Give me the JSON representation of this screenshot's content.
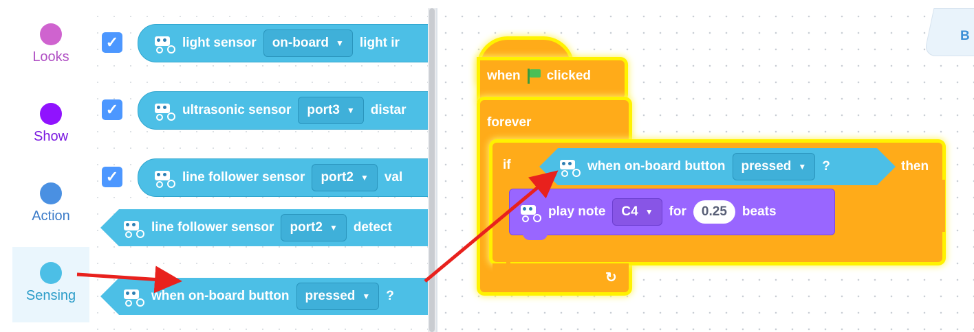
{
  "sidebar": {
    "categories": [
      {
        "label": "Looks",
        "color": "#cf63cf"
      },
      {
        "label": "Show",
        "color": "#9013fe"
      },
      {
        "label": "Action",
        "color": "#4a90e2"
      },
      {
        "label": "Sensing",
        "color": "#4cbfe6"
      }
    ]
  },
  "palette": {
    "blocks": [
      {
        "text": "light sensor",
        "dropdown": "on-board",
        "tail": "light ir",
        "checked": true
      },
      {
        "text": "ultrasonic sensor",
        "dropdown": "port3",
        "tail": "distar",
        "checked": true
      },
      {
        "text": "line follower sensor",
        "dropdown": "port2",
        "tail": "val",
        "checked": true
      },
      {
        "text": "line follower sensor",
        "dropdown": "port2",
        "tail": "detect"
      },
      {
        "text": "when on-board button",
        "dropdown": "pressed",
        "tail": "?"
      }
    ]
  },
  "workspace": {
    "tab_label": "B",
    "hat": {
      "when": "when",
      "clicked": "clicked"
    },
    "forever": "forever",
    "if": {
      "if": "if",
      "condition": "when on-board button",
      "dropdown": "pressed",
      "q": "?",
      "then": "then"
    },
    "note": {
      "play": "play note",
      "note": "C4",
      "for": "for",
      "beats_value": "0.25",
      "beats": "beats"
    },
    "loop_icon": "↻"
  },
  "colors": {
    "sensing": "#4cbfe6",
    "control": "#ffab19",
    "sound": "#9966ff",
    "glow": "#fff200",
    "arrow": "#e8211d"
  },
  "icons": [
    "check-icon",
    "dropdown-arrow-icon",
    "green-flag-icon",
    "loop-arrow-icon",
    "mbot-icon"
  ]
}
